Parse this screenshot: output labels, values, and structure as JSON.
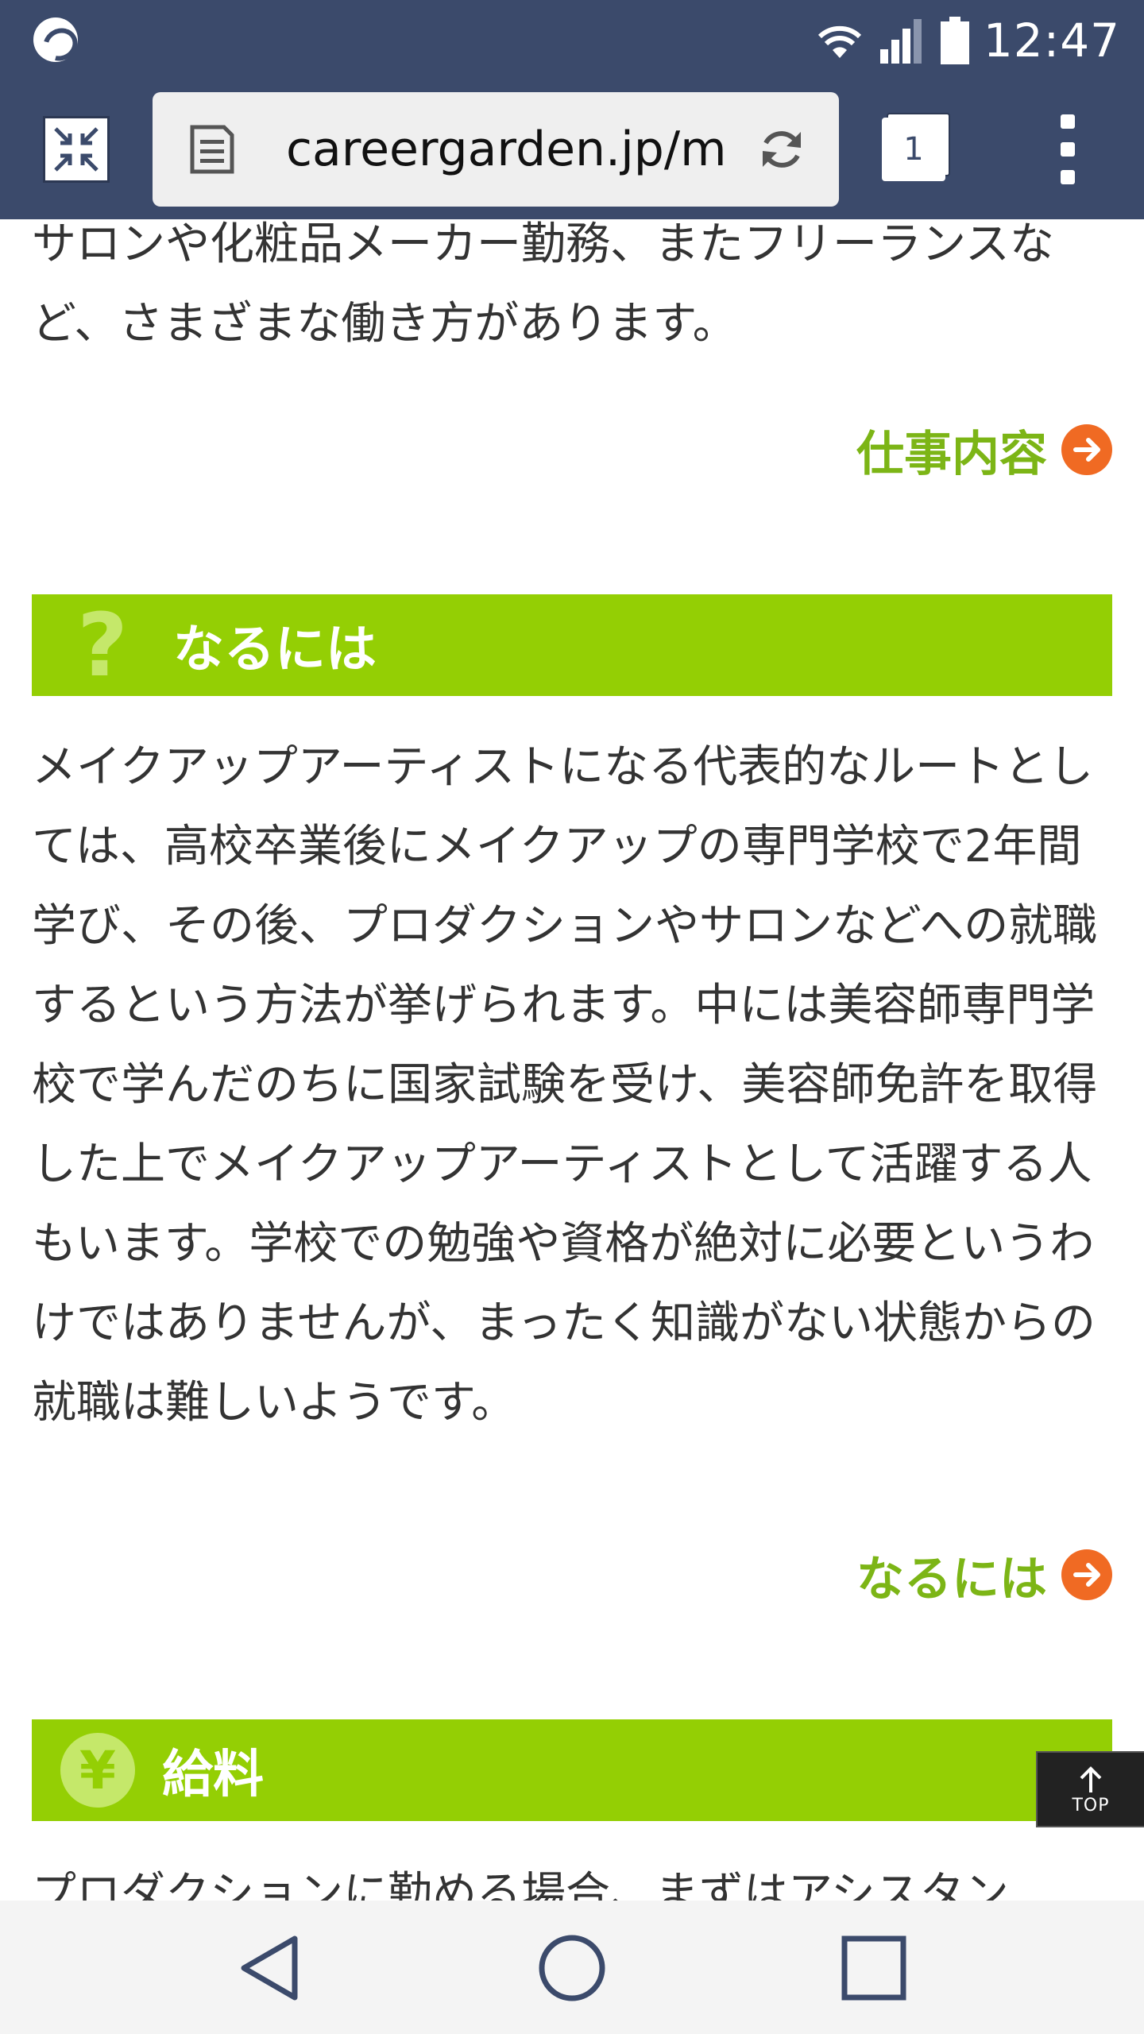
{
  "status_bar": {
    "time": "12:47"
  },
  "browser": {
    "url": "careergarden.jp/m",
    "tab_count": "1"
  },
  "content": {
    "intro_text": "サロンや化粧品メーカー勤務、またフリーランスなど、さまざまな働き方があります。",
    "intro_link": "仕事内容",
    "sections": [
      {
        "icon": "?",
        "title": "なるには",
        "body": "メイクアップアーティストになる代表的なルートとしては、高校卒業後にメイクアップの専門学校で2年間学び、その後、プロダクションやサロンなどへの就職するという方法が挙げられます。中には美容師専門学校で学んだのちに国家試験を受け、美容師免許を取得した上でメイクアップアーティストとして活躍する人もいます。学校での勉強や資格が絶対に必要というわけではありませんが、まったく知識がない状態からの就職は難しいようです。",
        "link": "なるには"
      },
      {
        "icon": "¥",
        "title": "給料",
        "body": "プロダクションに勤める場合、まずはアシスタン"
      }
    ],
    "top_button": "TOP"
  }
}
